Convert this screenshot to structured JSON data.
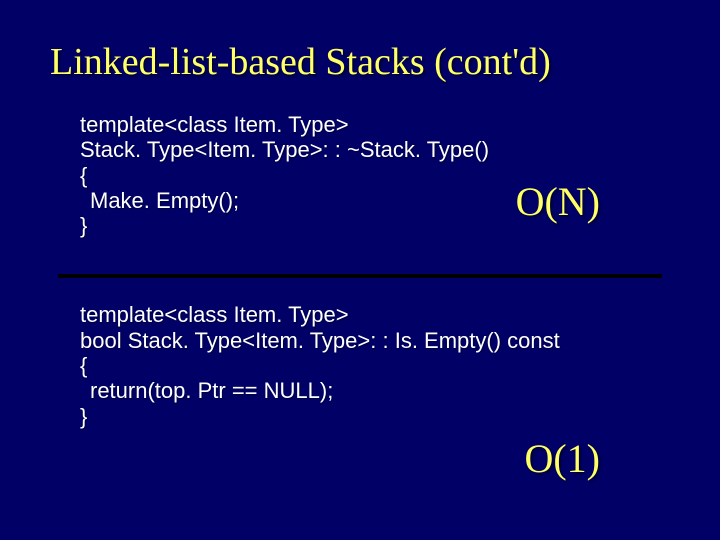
{
  "title": "Linked-list-based Stacks (cont'd)",
  "block1": {
    "line1": "template<class Item. Type>",
    "line2": "Stack. Type<Item. Type>: : ~Stack. Type()",
    "line3": "{",
    "line4": "Make. Empty();",
    "line5": "}",
    "complexity": "O(N)"
  },
  "block2": {
    "line1": "template<class Item. Type>",
    "line2": "bool Stack. Type<Item. Type>: : Is. Empty() const",
    "line3": "{",
    "line4": "return(top. Ptr == NULL);",
    "line5": "}",
    "complexity": "O(1)"
  }
}
